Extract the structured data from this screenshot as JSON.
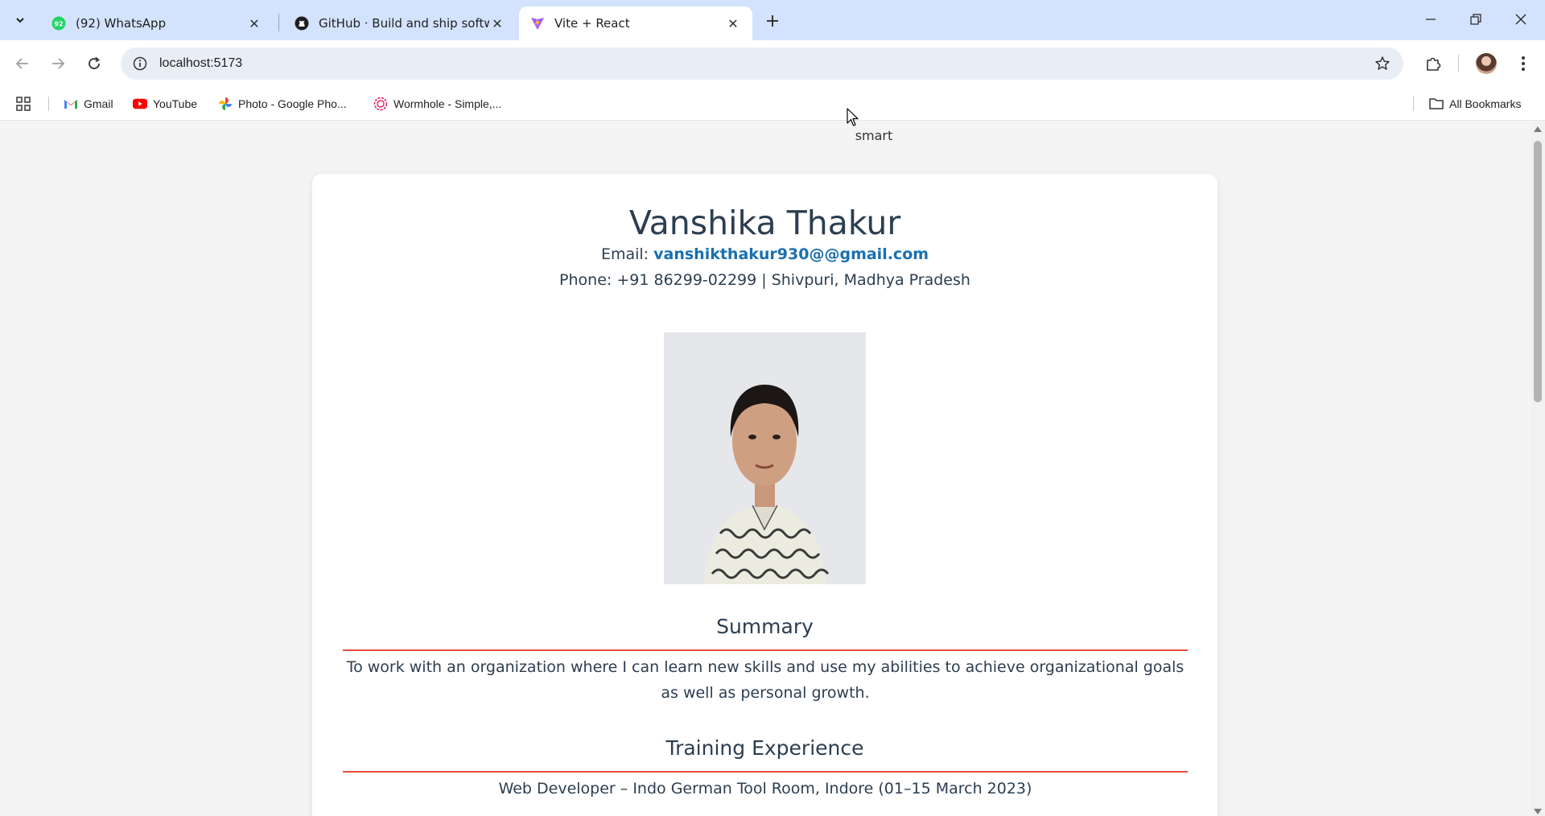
{
  "browser": {
    "tabs": [
      {
        "title": "(92) WhatsApp",
        "badge": "92",
        "icon": "whatsapp-icon"
      },
      {
        "title": "GitHub · Build and ship software",
        "icon": "github-icon"
      },
      {
        "title": "Vite + React",
        "icon": "vite-icon",
        "active": true
      }
    ],
    "address": "localhost:5173",
    "bookmarks": [
      {
        "label": "Gmail",
        "icon": "gmail-icon"
      },
      {
        "label": "YouTube",
        "icon": "youtube-icon"
      },
      {
        "label": "Photo - Google Pho...",
        "icon": "google-photos-icon"
      },
      {
        "label": "Wormhole - Simple,...",
        "icon": "wormhole-icon"
      }
    ],
    "all_bookmarks": "All Bookmarks"
  },
  "page": {
    "top_text": "smart",
    "name": "Vanshika Thakur",
    "email_label": "Email:",
    "email": "vanshikthakur930@@gmail.com",
    "phone_line": "Phone: +91 86299-02299 | Shivpuri, Madhya Pradesh",
    "summary_title": "Summary",
    "summary_text": "To work with an organization where I can learn new skills and use my abilities to achieve organizational goals as well as personal growth.",
    "training_title": "Training Experience",
    "training_item": "Web Developer – Indo German Tool Room, Indore (01–15 March 2023)"
  },
  "colors": {
    "tabstrip": "#d3e3fd",
    "heading": "#2c3e50",
    "link": "#1a6fb0",
    "rule": "#e74c3c"
  }
}
